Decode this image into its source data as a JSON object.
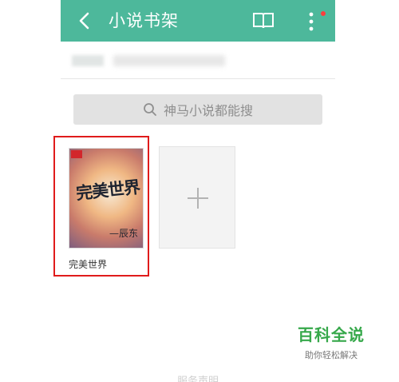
{
  "header": {
    "title": "小说书架",
    "icons": [
      "back-arrow-icon",
      "book-open-icon",
      "more-vertical-icon"
    ],
    "accent": "#4db89b"
  },
  "search": {
    "placeholder": "神马小说都能搜"
  },
  "shelf": {
    "books": [
      {
        "name": "完美世界",
        "cover_title": "完美世界",
        "cover_author": "—辰东"
      }
    ],
    "add_icon": "plus-icon"
  },
  "footer": {
    "text": "服务声明"
  },
  "watermark": {
    "main": "百科全说",
    "sub": "助你轻松解决"
  }
}
